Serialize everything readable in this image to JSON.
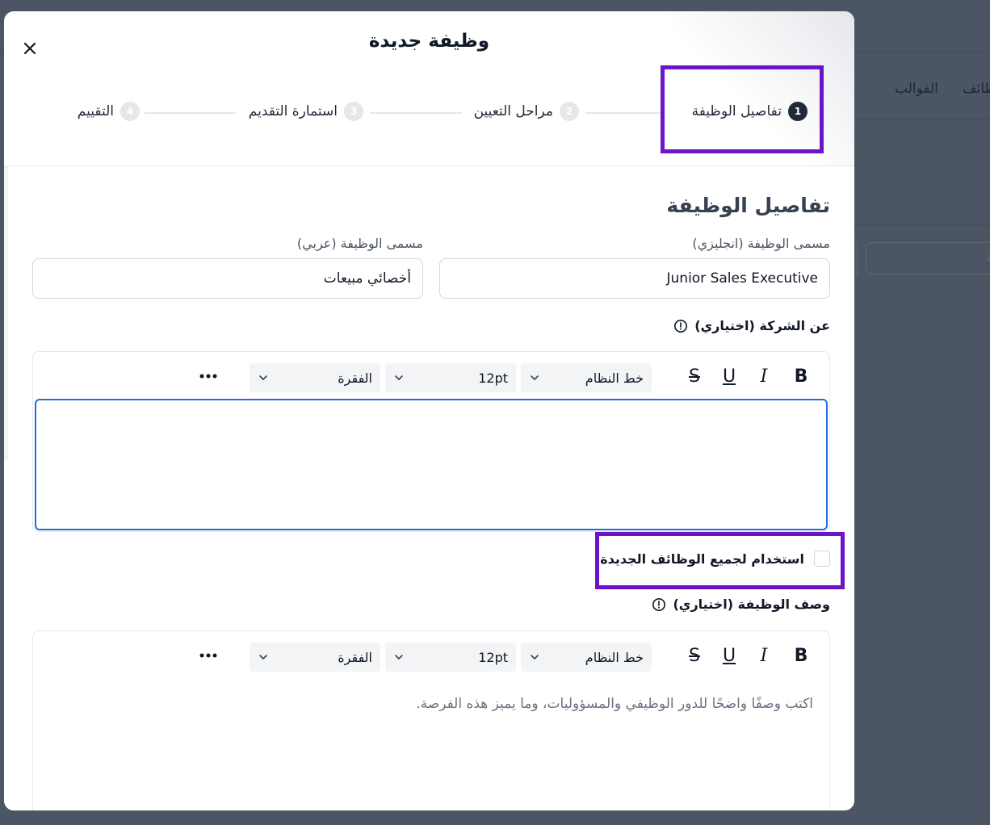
{
  "background": {
    "tabs": [
      {
        "label": "القوالب"
      },
      {
        "label": "ظائف"
      }
    ],
    "search_placeholder": "فة"
  },
  "modal": {
    "title": "وظيفة جديدة",
    "steps": [
      {
        "num": "1",
        "label": "تفاصيل الوظيفة",
        "active": true
      },
      {
        "num": "2",
        "label": "مراحل التعيين",
        "active": false
      },
      {
        "num": "3",
        "label": "استمارة التقديم",
        "active": false
      },
      {
        "num": "4",
        "label": "التقييم",
        "active": false
      }
    ],
    "section_title": "تفاصيل الوظيفة",
    "job_title_en": {
      "label": "مسمى الوظيفة (انجليزي)",
      "value": "Junior Sales Executive"
    },
    "job_title_ar": {
      "label": "مسمى الوظيفة (عربي)",
      "value": "أخصائي مبيعات"
    },
    "about_company": {
      "label": "عن الشركة (اختياري)",
      "toolbar": {
        "bold": "B",
        "italic": "I",
        "underline": "U",
        "strike": "S",
        "font": "خط النظام",
        "size": "12pt",
        "block": "الفقرة"
      },
      "value": ""
    },
    "use_for_all": {
      "label": "استخدام لجميع الوظائف الجديدة",
      "checked": false
    },
    "job_description": {
      "label": "وصف الوظيفة (اختياري)",
      "toolbar": {
        "bold": "B",
        "italic": "I",
        "underline": "U",
        "strike": "S",
        "font": "خط النظام",
        "size": "12pt",
        "block": "الفقرة"
      },
      "placeholder": "اكتب وصفًا واضحًا للدور الوظيفي والمسؤوليات، وما يميز هذه الفرصة."
    },
    "colors": {
      "highlight": "#6d13c9",
      "focus": "#1e6fd9",
      "active_step": "#1f2937"
    }
  }
}
